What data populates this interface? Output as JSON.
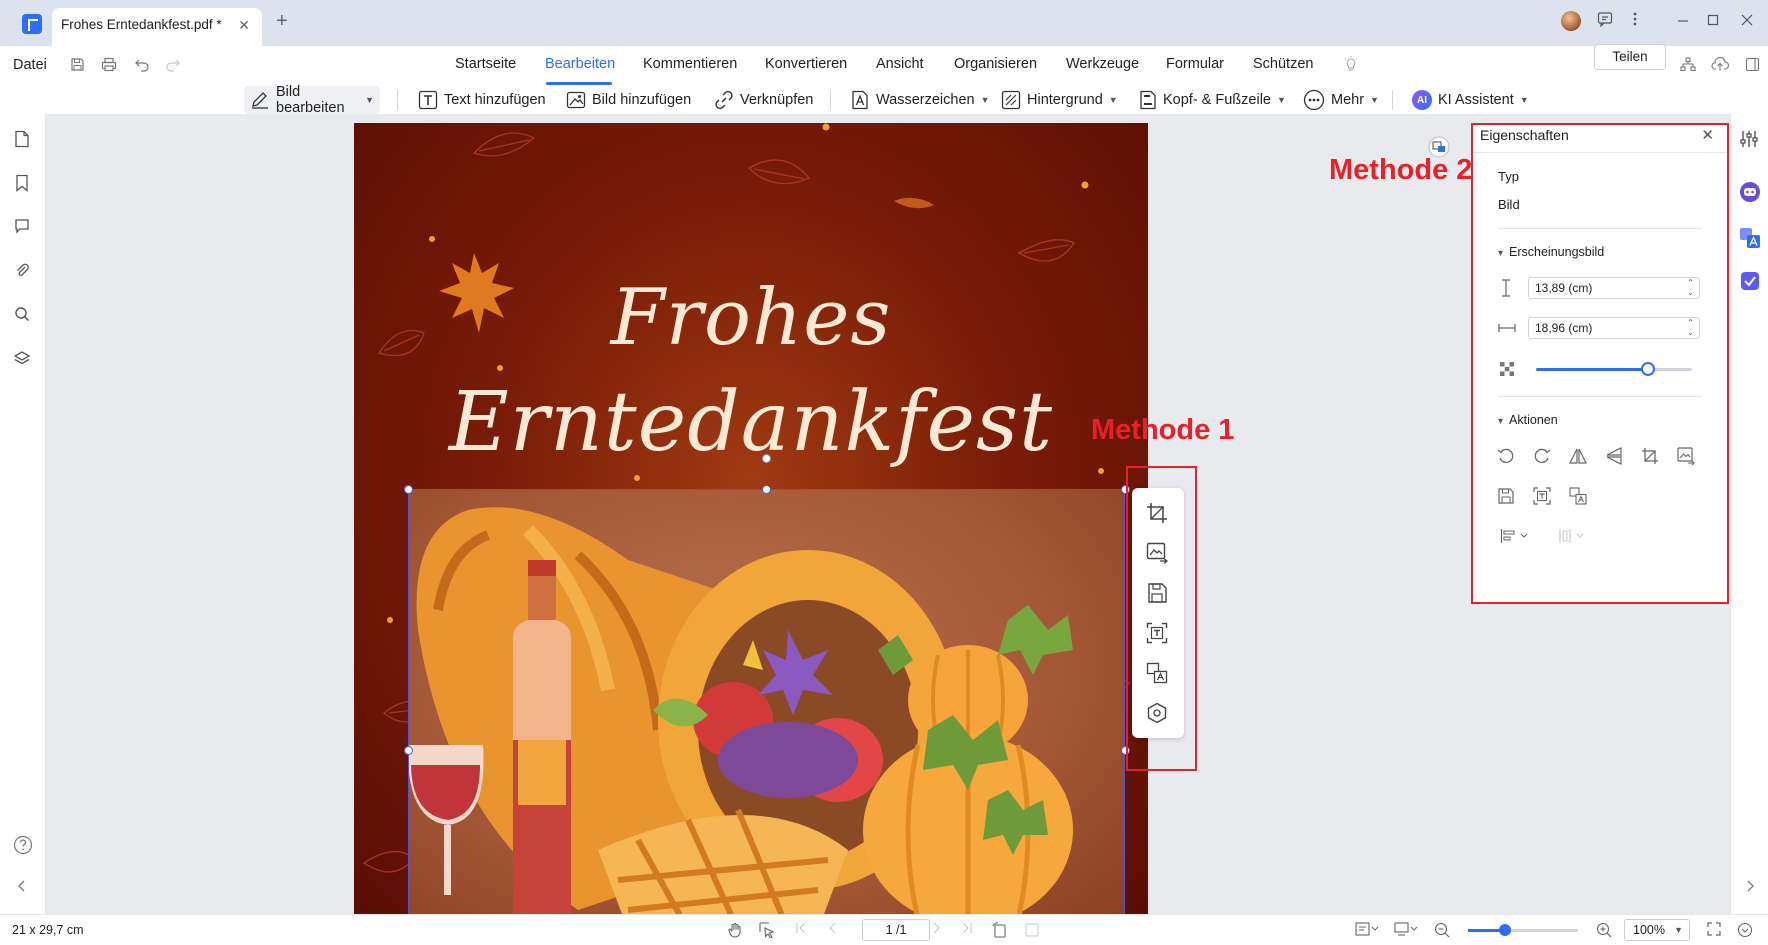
{
  "titlebar": {
    "tab_label": "Frohes Erntedankfest.pdf *",
    "close_glyph": "✕",
    "new_tab_glyph": "+"
  },
  "menu": {
    "file": "Datei",
    "tabs": [
      "Startseite",
      "Bearbeiten",
      "Kommentieren",
      "Konvertieren",
      "Ansicht",
      "Organisieren",
      "Werkzeuge",
      "Formular",
      "Schützen"
    ],
    "active_tab": "Bearbeiten",
    "share": "Teilen"
  },
  "toolbar": {
    "edit_image": "Bild bearbeiten",
    "add_text": "Text hinzufügen",
    "add_image": "Bild hinzufügen",
    "link": "Verknüpfen",
    "watermark": "Wasserzeichen",
    "background": "Hintergrund",
    "header_footer": "Kopf- & Fußzeile",
    "more": "Mehr",
    "ai_badge": "AI",
    "ai_assistant": "KI Assistent"
  },
  "document": {
    "heading_line1": "Frohes",
    "heading_line2": "Erntedankfest"
  },
  "annotations": {
    "method1": "Methode 1",
    "method2": "Methode 2"
  },
  "properties": {
    "title": "Eigenschaften",
    "type_label": "Typ",
    "type_value": "Bild",
    "appearance_section": "Erscheinungsbild",
    "height_value": "13,89 (cm)",
    "width_value": "18,96 (cm)",
    "opacity_fraction": 0.72,
    "actions_section": "Aktionen"
  },
  "statusbar": {
    "page_size": "21 x 29,7 cm",
    "page_indicator": "1 /1",
    "zoom_fraction": 0.34,
    "zoom_value": "100%"
  },
  "colors": {
    "accent": "#2f6df6",
    "annotation_red": "#e5222a",
    "page_background": "#7a1c08",
    "heading_text": "#fbe9d3"
  },
  "icons": [
    "save-icon",
    "print-icon",
    "undo-icon",
    "redo-icon",
    "crop-icon",
    "replace-image-icon",
    "extract-image-icon",
    "ocr-icon",
    "image-to-text-icon",
    "ai-icon",
    "rotate-left-icon",
    "rotate-right-icon",
    "flip-horizontal-icon",
    "flip-vertical-icon",
    "align-left-icon",
    "distribute-icon"
  ]
}
